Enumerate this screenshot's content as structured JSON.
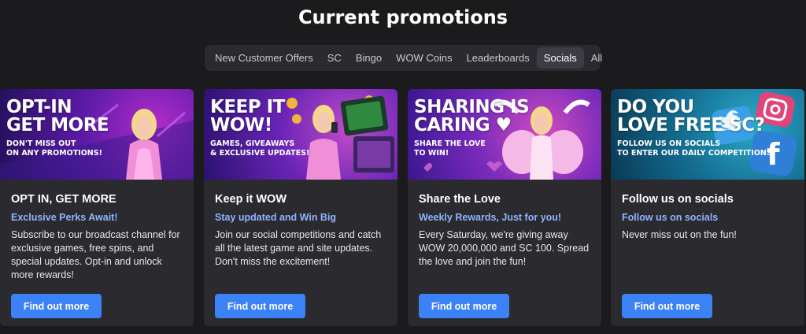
{
  "page": {
    "title": "Current promotions"
  },
  "tabs": [
    {
      "label": "New Customer Offers",
      "active": false
    },
    {
      "label": "SC",
      "active": false
    },
    {
      "label": "Bingo",
      "active": false
    },
    {
      "label": "WOW Coins",
      "active": false
    },
    {
      "label": "Leaderboards",
      "active": false
    },
    {
      "label": "Socials",
      "active": true
    },
    {
      "label": "All",
      "active": false
    }
  ],
  "cards": [
    {
      "banner_headline": "OPT-IN\nGET MORE",
      "banner_sub": "DON'T MISS OUT\nON ANY PROMOTIONS!",
      "title": "OPT IN, GET MORE",
      "subtitle": "Exclusive Perks Await!",
      "description": "Subscribe to our broadcast channel for exclusive games, free spins, and special updates. Opt-in and unlock more rewards!",
      "cta": "Find out more",
      "banner_colors": [
        "#2a1466",
        "#6b1aa8"
      ]
    },
    {
      "banner_headline": "KEEP IT\nWOW!",
      "banner_sub": "GAMES, GIVEAWAYS\n& EXCLUSIVE UPDATES!",
      "title": "Keep it WOW",
      "subtitle": "Stay updated and Win Big",
      "description": "Join our social competitions and catch all the latest game and site updates. Don't miss the excitement!",
      "cta": "Find out more",
      "banner_colors": [
        "#3a1680",
        "#7a2cc0"
      ]
    },
    {
      "banner_headline": "SHARING IS\nCARING ♥",
      "banner_sub": "SHARE THE LOVE\nTO WIN!",
      "title": "Share the Love",
      "subtitle": "Weekly Rewards, Just for you!",
      "description": "Every Saturday, we're giving away WOW 20,000,000 and SC 100. Spread the love and join the fun!",
      "cta": "Find out more",
      "banner_colors": [
        "#4a1a9a",
        "#b03ab8"
      ]
    },
    {
      "banner_headline": "DO YOU\nLOVE FREE SC?",
      "banner_sub": "FOLLOW US ON SOCIALS\nTO ENTER OUR DAILY COMPETITIONS",
      "title": "Follow us on socials",
      "subtitle": "Follow us on socials",
      "description": "Never miss out on the fun!",
      "cta": "Find out more",
      "banner_colors": [
        "#0e4f6e",
        "#1a7fa6"
      ]
    }
  ]
}
